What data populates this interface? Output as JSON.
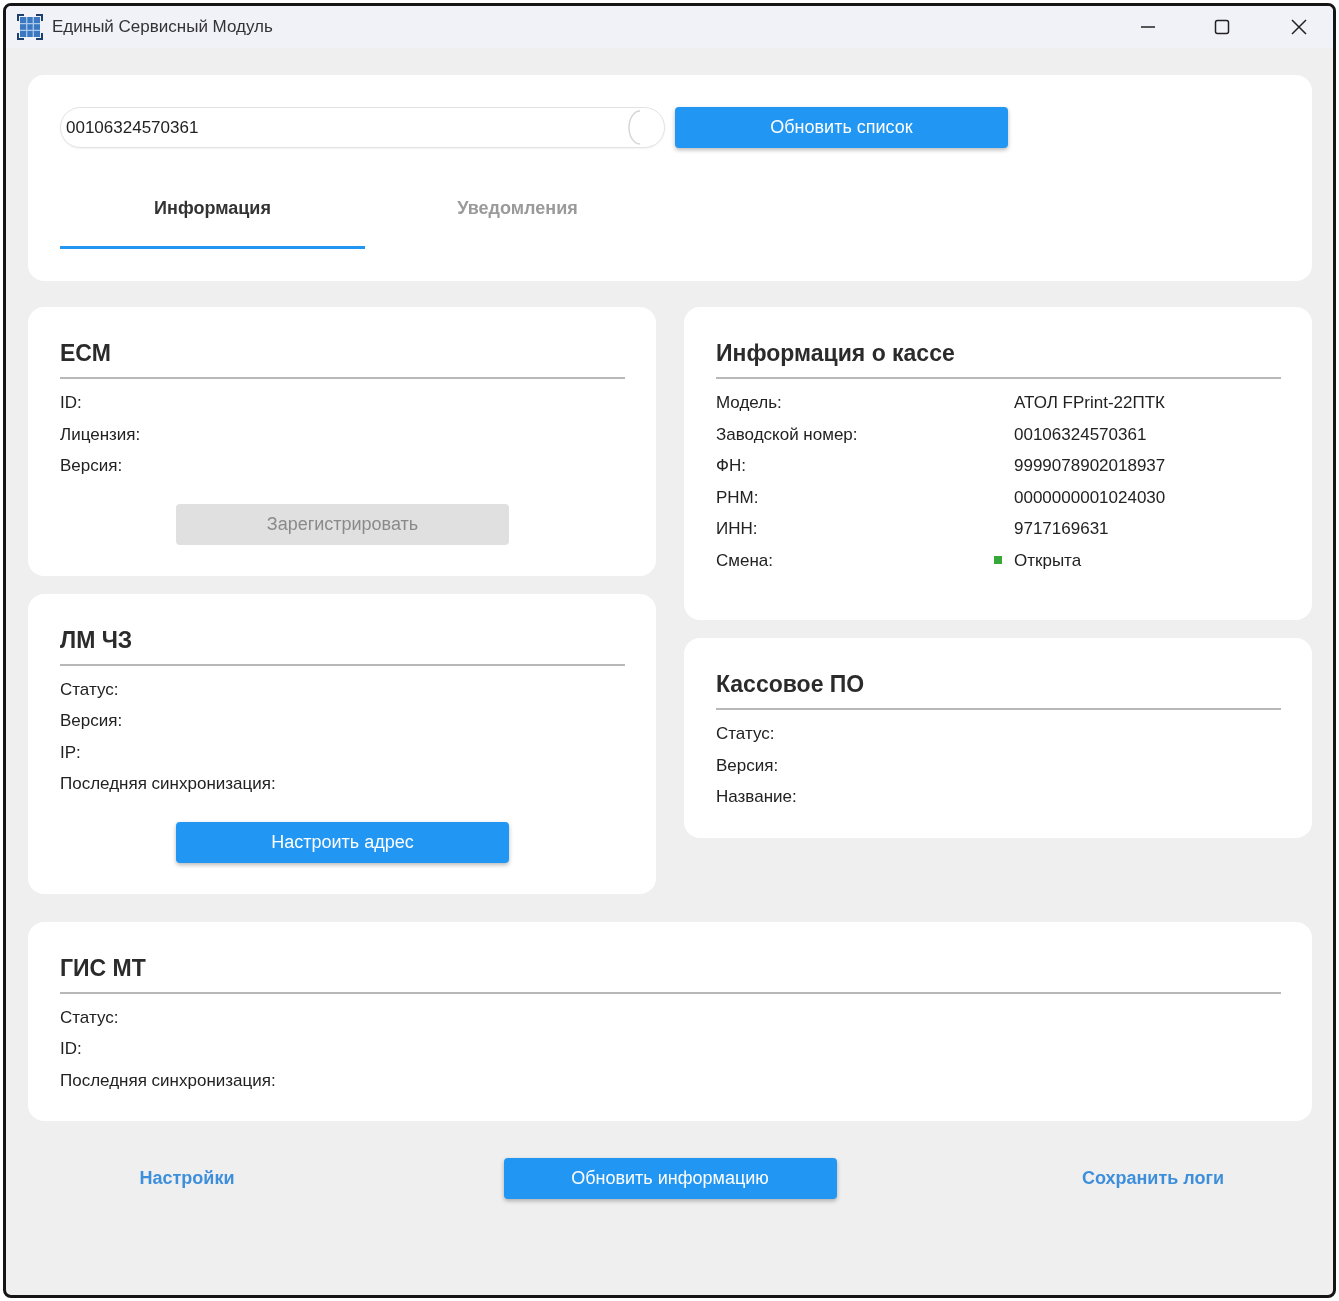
{
  "window": {
    "title": "Единый Сервисный Модуль"
  },
  "device_field": {
    "value": "00106324570361"
  },
  "refresh_button": {
    "label": "Обновить список"
  },
  "tabs": [
    {
      "label": "Информация",
      "selected": true
    },
    {
      "label": "Уведомления",
      "selected": false
    }
  ],
  "left_panels": [
    {
      "title": "ЕСМ",
      "rows": [
        {
          "label": "ID:"
        },
        {
          "label": "Лицензия:"
        },
        {
          "label": "Версия:"
        }
      ],
      "button": {
        "label": "Зарегистрировать",
        "disabled": true
      }
    },
    {
      "title": "ЛМ ЧЗ",
      "rows": [
        {
          "label": "Статус:"
        },
        {
          "label": "Версия:"
        },
        {
          "label": "IP:"
        },
        {
          "label": "Последняя синхронизация:"
        }
      ],
      "button": {
        "label": "Настроить адрес",
        "disabled": false
      }
    }
  ],
  "right_panels": [
    {
      "title": "Информация о кассе",
      "rows": [
        {
          "label": "Модель:",
          "value": "АТОЛ FPrint-22ПТК"
        },
        {
          "label": "Заводской номер:",
          "value": "00106324570361"
        },
        {
          "label": "ФН:",
          "value": "9999078902018937"
        },
        {
          "label": "РНМ:",
          "value": "0000000001024030"
        },
        {
          "label": "ИНН:",
          "value": "9717169631"
        },
        {
          "label": "Смена:",
          "value": "Открыта",
          "color": "#35a838"
        }
      ]
    },
    {
      "title": "Кассовое ПО",
      "rows": [
        {
          "label": "Статус:"
        },
        {
          "label": "Версия:"
        },
        {
          "label": "Название:"
        }
      ]
    }
  ],
  "bottom_panel": {
    "title": "ГИС МТ",
    "rows": [
      {
        "label": "Статус:"
      },
      {
        "label": "ID:"
      },
      {
        "label": "Последняя синхронизация:"
      }
    ]
  },
  "footer": [
    {
      "kind": "link",
      "label": "Настройки"
    },
    {
      "kind": "button",
      "label": "Обновить информацию"
    },
    {
      "kind": "link",
      "label": "Сохранить логи"
    }
  ]
}
